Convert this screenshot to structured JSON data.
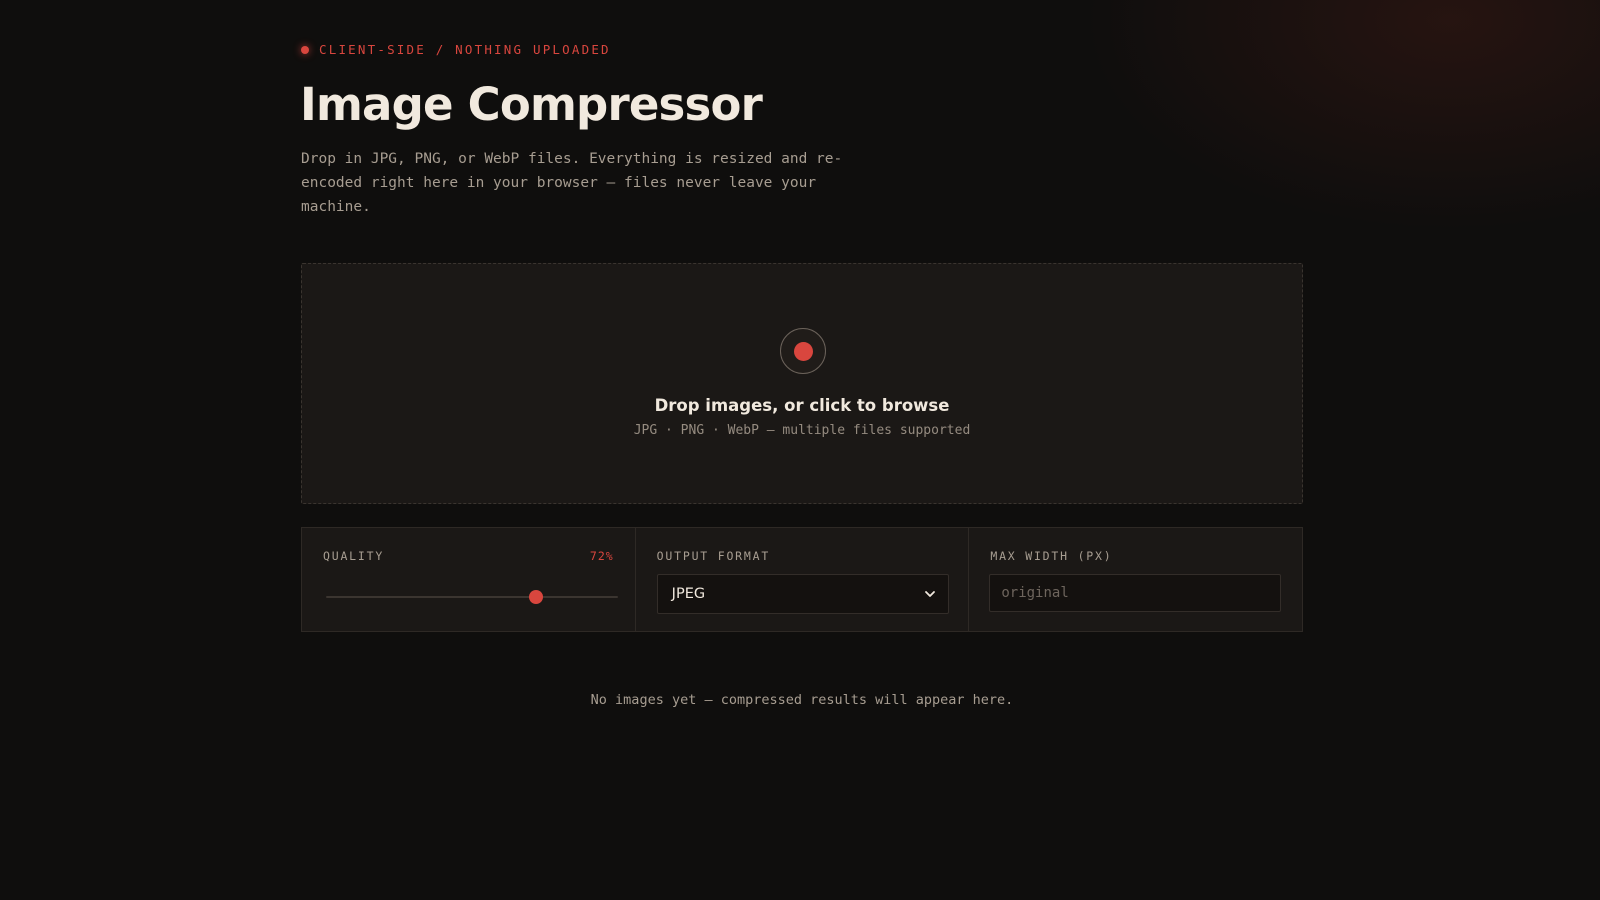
{
  "header": {
    "eyebrow": "CLIENT-SIDE / NOTHING UPLOADED",
    "title": "Image Compressor",
    "description": "Drop in JPG, PNG, or WebP files. Everything is resized and re-encoded right here in your browser — files never leave your machine."
  },
  "dropzone": {
    "title": "Drop images, or click to browse",
    "subtitle": "JPG · PNG · WebP — multiple files supported",
    "icon": "record-dot-icon"
  },
  "controls": {
    "quality": {
      "label": "QUALITY",
      "value_text": "72%",
      "value": 72,
      "min": 0,
      "max": 100
    },
    "format": {
      "label": "OUTPUT FORMAT",
      "selected": "JPEG"
    },
    "max_width": {
      "label": "MAX WIDTH (PX)",
      "value": "",
      "placeholder": "original"
    }
  },
  "results": {
    "empty_text": "No images yet — compressed results will appear here."
  },
  "colors": {
    "accent": "#d9463e",
    "background": "#0f0e0d",
    "panel": "#1b1816",
    "text": "#f1e9de",
    "muted": "#a79d91"
  }
}
